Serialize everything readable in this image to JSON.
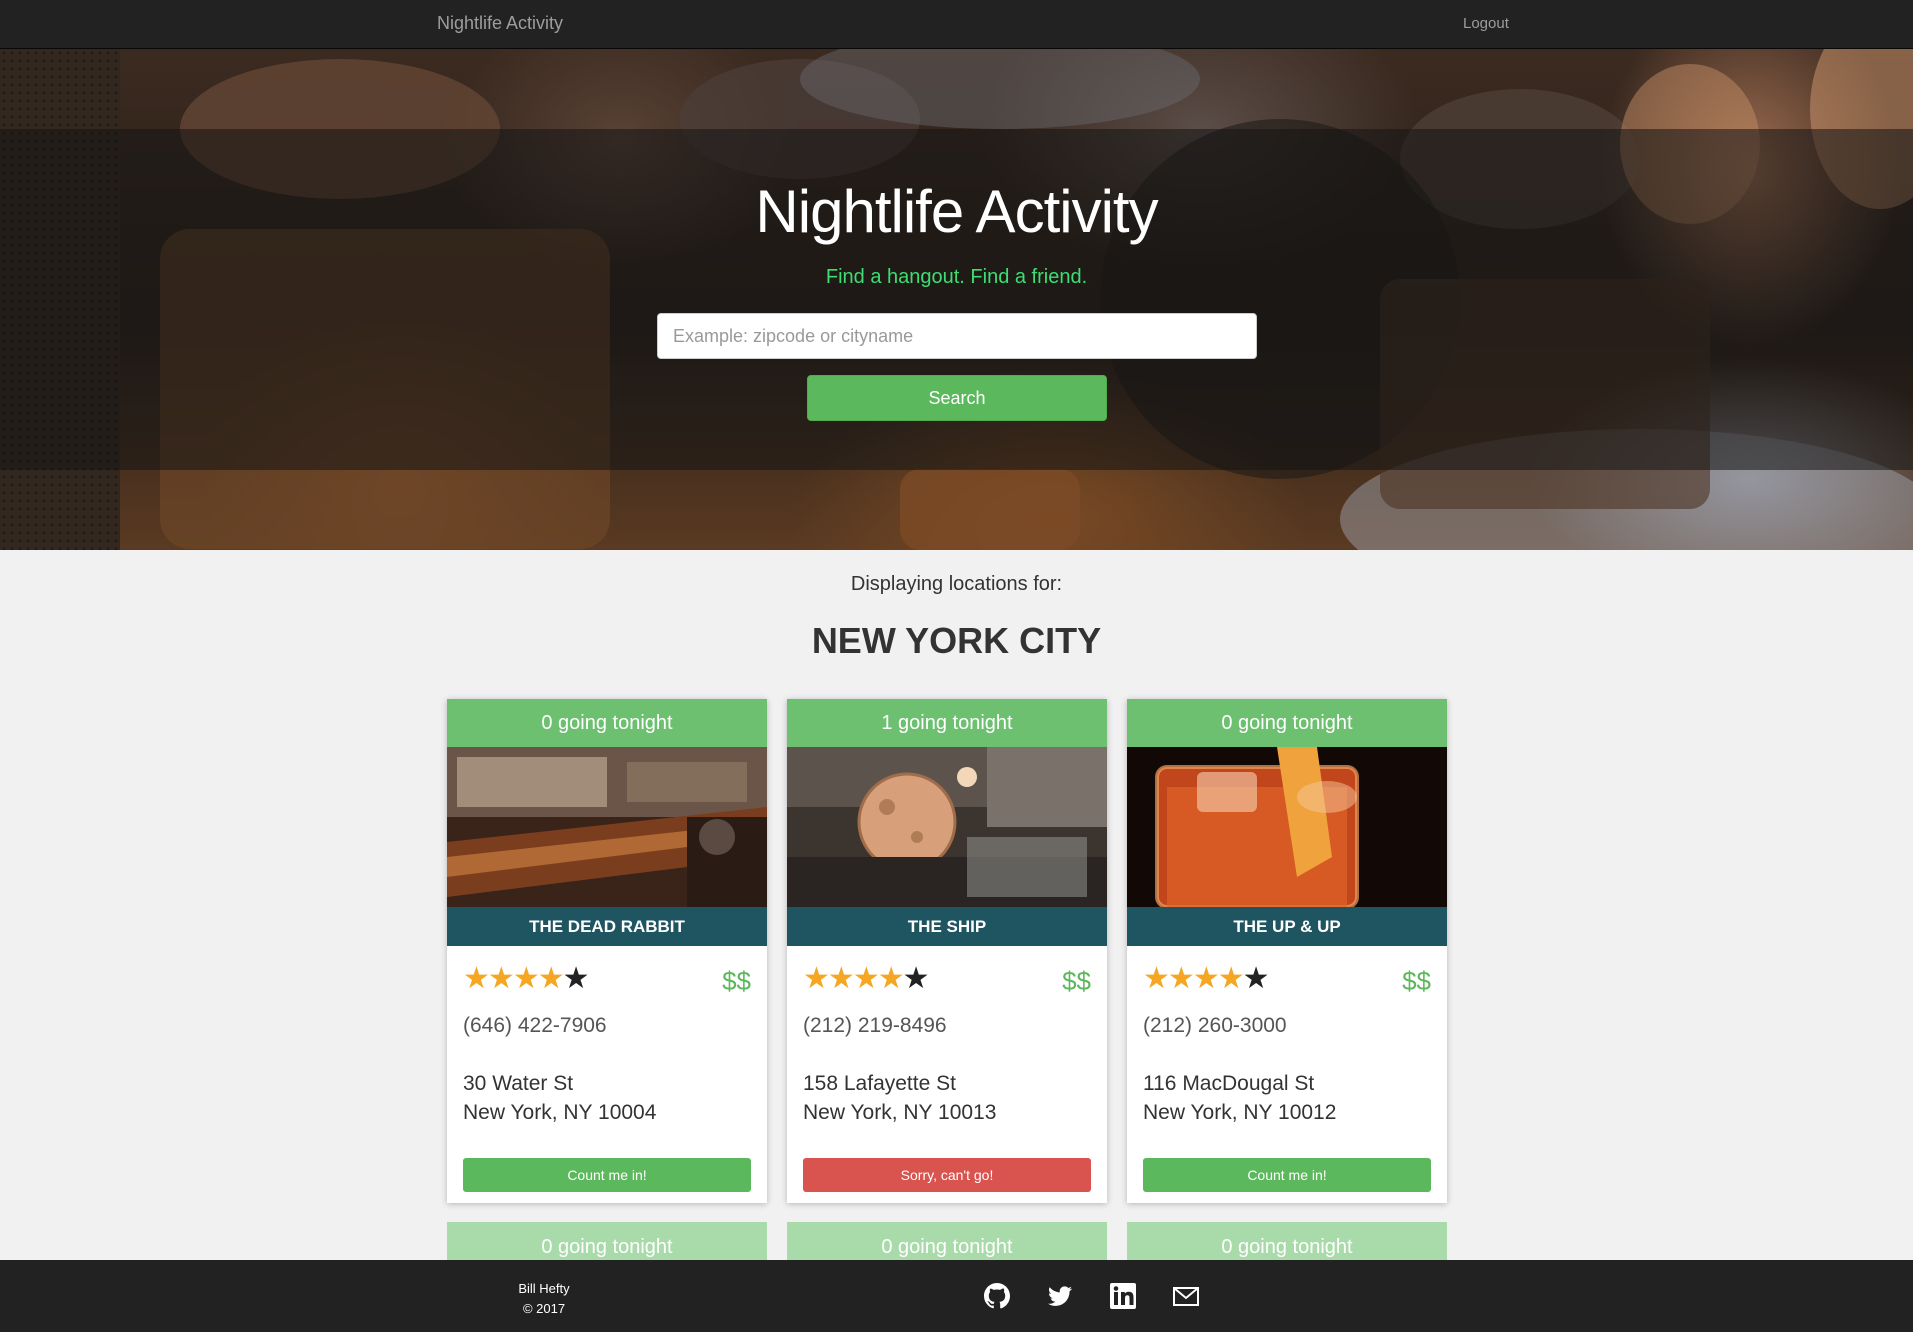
{
  "navbar": {
    "brand": "Nightlife Activity",
    "logout": "Logout"
  },
  "hero": {
    "title": "Nightlife Activity",
    "subtitle": "Find a hangout. Find a friend.",
    "search_placeholder": "Example: zipcode or cityname",
    "search_value": "",
    "search_button": "Search"
  },
  "results": {
    "displaying": "Displaying locations for:",
    "city": "NEW YORK CITY"
  },
  "cards": [
    {
      "going": "0 going tonight",
      "name": "THE DEAD RABBIT",
      "rating": 4,
      "price": "$$",
      "phone": "(646) 422-7906",
      "address1": "30 Water St",
      "address2": "New York, NY 10004",
      "button": "Count me in!",
      "button_style": "green",
      "image": "bar-interior-photo"
    },
    {
      "going": "1 going tonight",
      "name": "THE SHIP",
      "rating": 4,
      "price": "$$",
      "phone": "(212) 219-8496",
      "address1": "158 Lafayette St",
      "address2": "New York, NY 10013",
      "button": "Sorry, can't go!",
      "button_style": "red",
      "image": "ship-interior-photo"
    },
    {
      "going": "0 going tonight",
      "name": "THE UP & UP",
      "rating": 4,
      "price": "$$",
      "phone": "(212) 260-3000",
      "address1": "116 MacDougal St",
      "address2": "New York, NY 10012",
      "button": "Count me in!",
      "button_style": "green",
      "image": "cocktail-photo"
    }
  ],
  "next_row": [
    {
      "going": "0 going tonight"
    },
    {
      "going": "0 going tonight"
    },
    {
      "going": "0 going tonight"
    }
  ],
  "footer": {
    "author": "Bill Hefty",
    "copyright": "© 2017",
    "social": [
      "github-icon",
      "twitter-icon",
      "linkedin-icon",
      "mail-icon"
    ]
  },
  "colors": {
    "accent_green": "#5cb85c",
    "danger_red": "#d9534f",
    "name_band": "#1f5560",
    "subtitle_green": "#3cde74",
    "star_gold": "#f5a623"
  }
}
